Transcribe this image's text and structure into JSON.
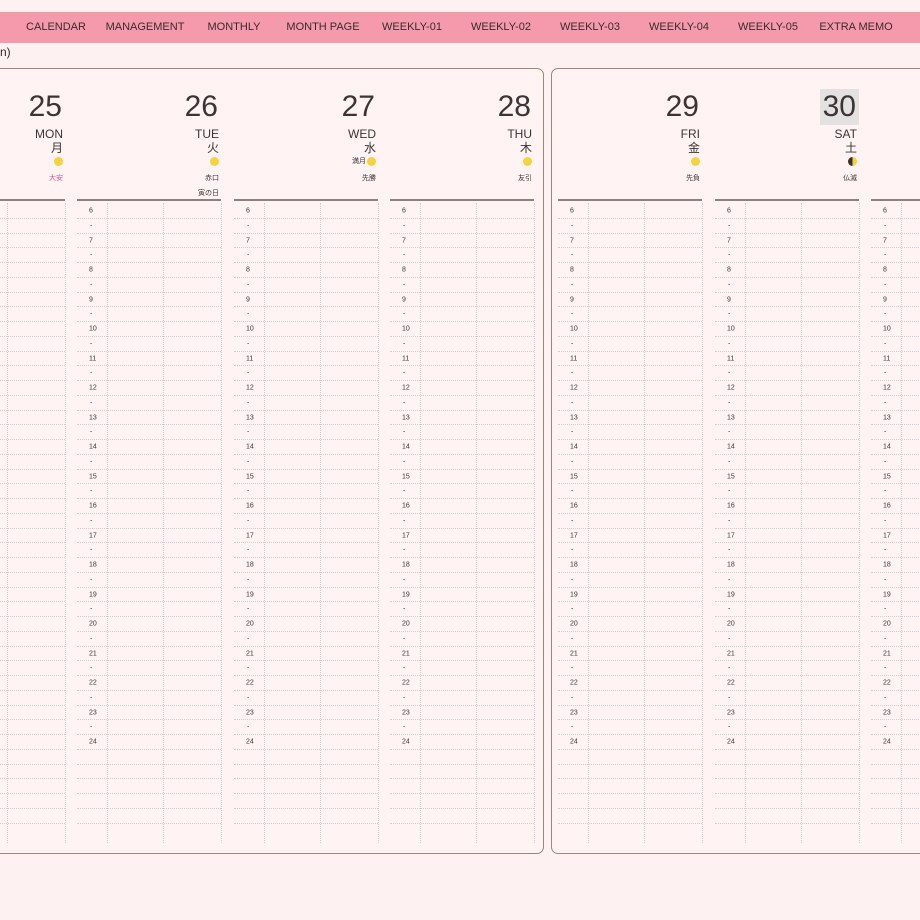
{
  "nav": {
    "items": [
      "CALENDAR",
      "MANAGEMENT",
      "MONTHLY",
      "MONTH PAGE",
      "WEEKLY-01",
      "WEEKLY-02",
      "WEEKLY-03",
      "WEEKLY-04",
      "WEEKLY-05",
      "EXTRA MEMO"
    ],
    "back_text": "n)"
  },
  "colors": {
    "nav_bg": "#f59aac",
    "page_bg": "#fdf1f1",
    "moon": "#f5d340",
    "accent_red": "#e0508c",
    "today_highlight": "#e4e1e1"
  },
  "hours": [
    "6",
    "7",
    "8",
    "9",
    "10",
    "11",
    "12",
    "13",
    "14",
    "15",
    "16",
    "17",
    "18",
    "19",
    "20",
    "21",
    "22",
    "23",
    "24"
  ],
  "half_hour_mark": "-",
  "left_page": {
    "days": [
      {
        "num": "25",
        "en": "MON",
        "jp": "月",
        "phase": "",
        "moon": "full",
        "rokuyo": "大安",
        "rokuyo_red": true,
        "extra": ""
      },
      {
        "num": "26",
        "en": "TUE",
        "jp": "火",
        "phase": "",
        "moon": "full",
        "rokuyo": "赤口",
        "rokuyo_red": false,
        "extra": "寅の日"
      },
      {
        "num": "27",
        "en": "WED",
        "jp": "水",
        "phase": "満月",
        "moon": "full",
        "rokuyo": "先勝",
        "rokuyo_red": false,
        "extra": ""
      },
      {
        "num": "28",
        "en": "THU",
        "jp": "木",
        "phase": "",
        "moon": "full",
        "rokuyo": "友引",
        "rokuyo_red": false,
        "extra": ""
      }
    ]
  },
  "right_page": {
    "days": [
      {
        "num": "29",
        "en": "FRI",
        "jp": "金",
        "phase": "",
        "moon": "full",
        "rokuyo": "先負",
        "rokuyo_red": false,
        "extra": "",
        "today": false
      },
      {
        "num": "30",
        "en": "SAT",
        "jp": "土",
        "phase": "",
        "moon": "half",
        "rokuyo": "仏滅",
        "rokuyo_red": false,
        "extra": "",
        "today": true
      },
      {
        "num": "",
        "en": "",
        "jp": "",
        "phase": "",
        "moon": "none",
        "rokuyo": "",
        "rokuyo_red": false,
        "extra": "",
        "today": false
      }
    ]
  }
}
